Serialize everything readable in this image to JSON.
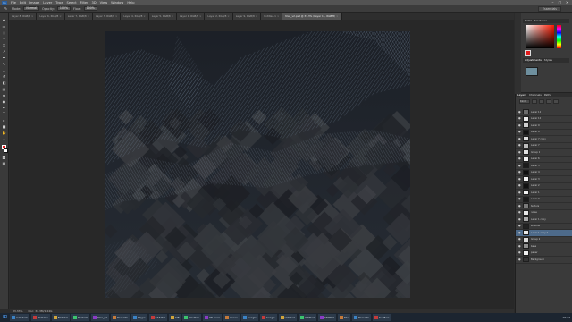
{
  "menu": {
    "app_icon": "Ps",
    "items": [
      "File",
      "Edit",
      "Image",
      "Layer",
      "Type",
      "Select",
      "Filter",
      "3D",
      "View",
      "Window",
      "Help"
    ]
  },
  "options": {
    "mode_label": "Mode:",
    "mode_value": "Normal",
    "opacity_label": "Opacity:",
    "opacity_value": "100%",
    "flow_label": "Flow:",
    "flow_value": "100%",
    "workspace": "Essentials"
  },
  "tabs": [
    {
      "label": "Layer 8, RGB/8",
      "active": false
    },
    {
      "label": "Layer 6, RGB/8",
      "active": false
    },
    {
      "label": "Layer 7, RGB/8",
      "active": false
    },
    {
      "label": "Layer 3, RGB/8",
      "active": false
    },
    {
      "label": "Layer 4, RGB/8",
      "active": false
    },
    {
      "label": "Layer 5, RGB/8",
      "active": false
    },
    {
      "label": "Layer 1, RGB/8",
      "active": false
    },
    {
      "label": "Layer 2, RGB/8",
      "active": false
    },
    {
      "label": "Layer 9, RGB/8",
      "active": false
    },
    {
      "label": "Untitled-1",
      "active": false
    },
    {
      "label": "tiles_v2.psd @ 33.3% (Layer 11, RGB/8)",
      "active": true
    }
  ],
  "status": {
    "zoom": "33.33%",
    "doc": "Doc: 34.3M/1.24G"
  },
  "panels": {
    "color_tabs": [
      "Color",
      "Swatches"
    ],
    "adj_tabs": [
      "Adjustments",
      "Styles"
    ],
    "layers_tabs": [
      "Layers",
      "Channels",
      "Paths"
    ],
    "layers_filter": "Kind"
  },
  "layers": [
    {
      "name": "Layer 11",
      "thumb": "#6b6b6b",
      "selected": false
    },
    {
      "name": "Layer 10",
      "thumb": "#e9e9e9",
      "selected": false
    },
    {
      "name": "Layer 9",
      "thumb": "#cfcfcf",
      "selected": false
    },
    {
      "name": "Layer 8",
      "thumb": "#111111",
      "selected": false
    },
    {
      "name": "Layer 7 copy",
      "thumb": "#dcdcdc",
      "selected": false
    },
    {
      "name": "Layer 7",
      "thumb": "#bcbcbc",
      "selected": false
    },
    {
      "name": "Group 1",
      "thumb": "#e0e0e0",
      "selected": false
    },
    {
      "name": "Layer 6",
      "thumb": "#f2f2f2",
      "selected": false
    },
    {
      "name": "Layer 5",
      "thumb": "#1b1b1b",
      "selected": false
    },
    {
      "name": "Layer 4",
      "thumb": "#0f0f0f",
      "selected": false
    },
    {
      "name": "Layer 3",
      "thumb": "#f4f4f4",
      "selected": false
    },
    {
      "name": "Layer 2",
      "thumb": "#111111",
      "selected": false
    },
    {
      "name": "Layer 1",
      "thumb": "#f1f1f1",
      "selected": false
    },
    {
      "name": "Layer 0",
      "thumb": "#1a1a1a",
      "selected": false
    },
    {
      "name": "texture",
      "thumb": "#7a7a7a",
      "selected": false
    },
    {
      "name": "noise",
      "thumb": "#e5e5e5",
      "selected": false
    },
    {
      "name": "Layer 1 copy",
      "thumb": "#a9a9a9",
      "selected": false
    },
    {
      "name": "shadow",
      "thumb": "#222222",
      "selected": false
    },
    {
      "name": "Layer 1 copy 2",
      "thumb": "#e9e9e9",
      "selected": true
    },
    {
      "name": "Group 2",
      "thumb": "#dcdcdc",
      "selected": false
    },
    {
      "name": "base",
      "thumb": "#8f8f8f",
      "selected": false
    },
    {
      "name": "paper",
      "thumb": "#efefef",
      "selected": false
    },
    {
      "name": "Background",
      "thumb": "#333333",
      "selected": false
    }
  ],
  "taskbar": {
    "tasks": [
      "Autodesk",
      "BAZ Ima",
      "BAZ Sm",
      "Photosh",
      "tiles_v2",
      "Recordin",
      "Skype",
      "BAZ Hel",
      "GIF",
      "Desktop",
      "3D Lines",
      "Xenon",
      "Google",
      "Google",
      "Untitled",
      "Untitled",
      "CR2004",
      "Kilo",
      "Recordin",
      "Sunflow"
    ],
    "time": "19:42"
  },
  "colors": {
    "accent": "#4d6a8a",
    "fg": "#e21b1b",
    "bg": "#ffffff"
  }
}
